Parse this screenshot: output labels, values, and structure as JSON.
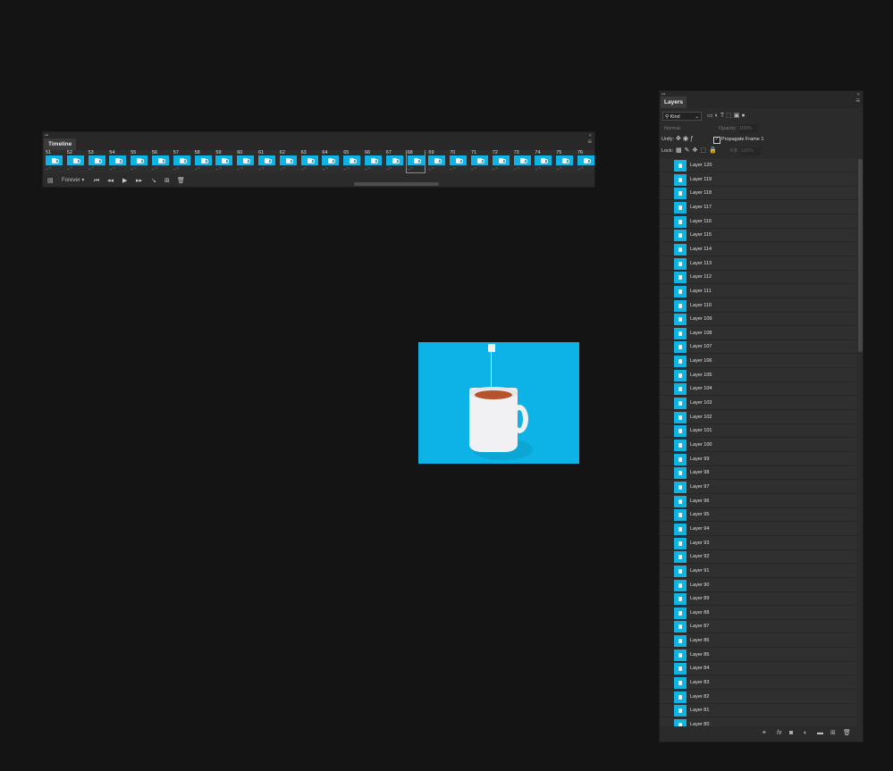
{
  "timeline": {
    "title": "Timeline",
    "frames": [
      {
        "num": "51",
        "delay": "... ~"
      },
      {
        "num": "52",
        "delay": "... ~"
      },
      {
        "num": "53",
        "delay": "... ~"
      },
      {
        "num": "54",
        "delay": "... ~"
      },
      {
        "num": "55",
        "delay": "... ~"
      },
      {
        "num": "56",
        "delay": "... ~"
      },
      {
        "num": "57",
        "delay": "... ~"
      },
      {
        "num": "58",
        "delay": "... ~"
      },
      {
        "num": "59",
        "delay": "... ~"
      },
      {
        "num": "60",
        "delay": "... ~"
      },
      {
        "num": "61",
        "delay": "... ~"
      },
      {
        "num": "62",
        "delay": "... ~"
      },
      {
        "num": "63",
        "delay": "... ~"
      },
      {
        "num": "64",
        "delay": "... ~"
      },
      {
        "num": "65",
        "delay": "... ~"
      },
      {
        "num": "66",
        "delay": "... ~"
      },
      {
        "num": "67",
        "delay": "... ~"
      },
      {
        "num": "68",
        "delay": "... ~"
      },
      {
        "num": "69",
        "delay": "... ~"
      },
      {
        "num": "70",
        "delay": "... ~"
      },
      {
        "num": "71",
        "delay": "... ~"
      },
      {
        "num": "72",
        "delay": "... ~"
      },
      {
        "num": "73",
        "delay": "... ~"
      },
      {
        "num": "74",
        "delay": "... ~"
      },
      {
        "num": "75",
        "delay": "... ~"
      },
      {
        "num": "76",
        "delay": "... ~"
      }
    ],
    "selected_frame": "68",
    "loop_label": "Forever",
    "icons": {
      "convert": "convert-to-video-timeline-icon",
      "first": "first-frame-icon",
      "prev": "previous-frame-icon",
      "play": "play-icon",
      "next": "next-frame-icon",
      "tween": "tween-icon",
      "duplicate": "duplicate-frame-icon",
      "delete": "delete-frame-icon"
    }
  },
  "canvas": {
    "background": "#0db3e6",
    "subject": "mug-with-tea-bag"
  },
  "layers": {
    "title": "Layers",
    "filter_kind": "Kind",
    "blend_mode": "Normal",
    "opacity_label": "Opacity:",
    "opacity_value": "100%",
    "unify_label": "Unify:",
    "propagate_label": "Propagate Frame 1",
    "lock_label": "Lock:",
    "fill_label": "Fill:",
    "fill_value": "100%",
    "items": [
      "Layer 120",
      "Layer 119",
      "Layer 118",
      "Layer 117",
      "Layer 116",
      "Layer 115",
      "Layer 114",
      "Layer 113",
      "Layer 112",
      "Layer 111",
      "Layer 110",
      "Layer 109",
      "Layer 108",
      "Layer 107",
      "Layer 106",
      "Layer 105",
      "Layer 104",
      "Layer 103",
      "Layer 102",
      "Layer 101",
      "Layer 100",
      "Layer 99",
      "Layer 98",
      "Layer 97",
      "Layer 96",
      "Layer 95",
      "Layer 94",
      "Layer 93",
      "Layer 92",
      "Layer 91",
      "Layer 90",
      "Layer 89",
      "Layer 88",
      "Layer 87",
      "Layer 86",
      "Layer 85",
      "Layer 84",
      "Layer 83",
      "Layer 82",
      "Layer 81",
      "Layer 80"
    ],
    "footer_icons": [
      "link-layers-icon",
      "fx-icon",
      "add-mask-icon",
      "adjustment-layer-icon",
      "new-group-icon",
      "new-layer-icon",
      "trash-icon"
    ]
  },
  "colors": {
    "app_background": "#141414",
    "panel": "#2b2b2b",
    "accent_thumb": "#0fb4e4"
  }
}
